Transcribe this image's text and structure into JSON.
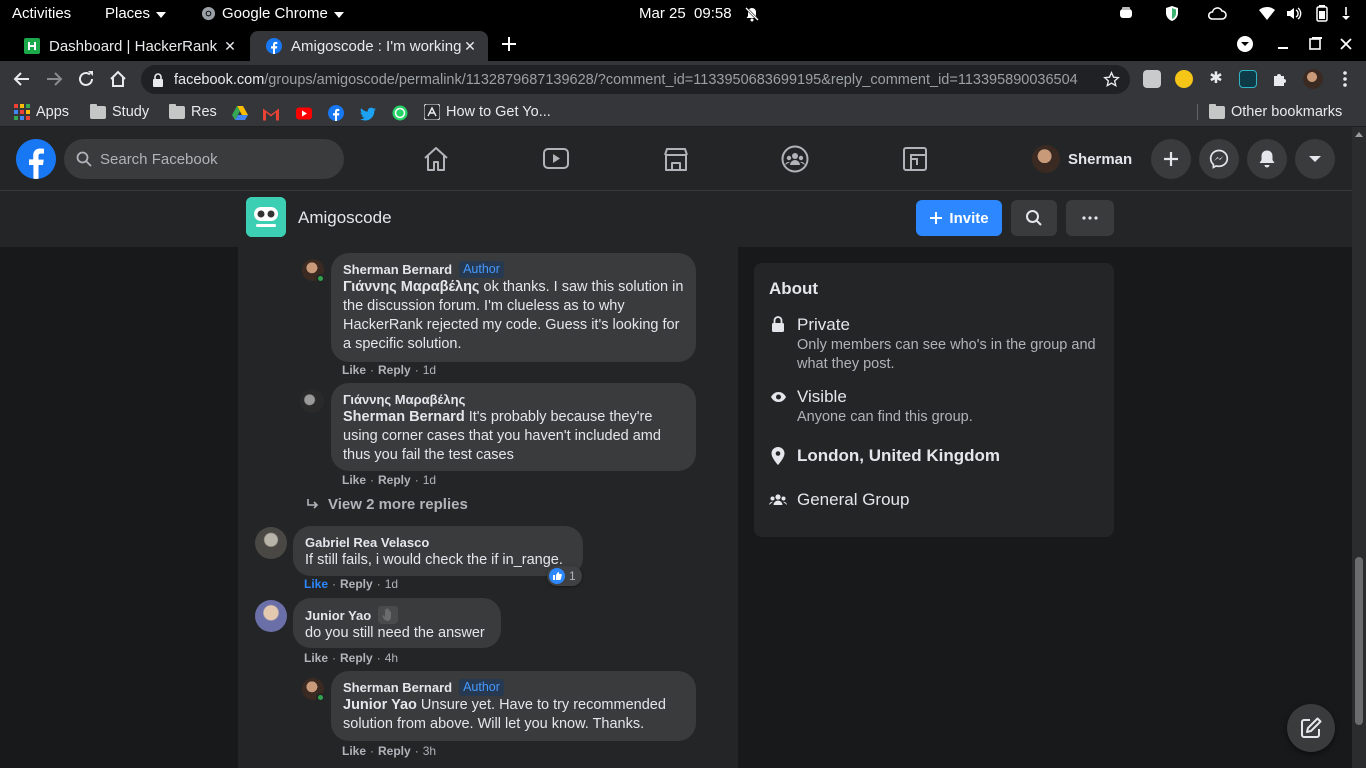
{
  "system_bar": {
    "activities": "Activities",
    "places": "Places",
    "app_name": "Google Chrome",
    "clock": "Mar 25  09:58"
  },
  "tabs": [
    {
      "title": "Dashboard | HackerRank",
      "active": false
    },
    {
      "title": "Amigoscode : I'm working on HackerRank",
      "active": true
    }
  ],
  "address_bar": {
    "domain": "facebook.com",
    "path": "/groups/amigoscode/permalink/1132879687139628/?comment_id=1133950683699195&reply_comment_id=113395890036504..."
  },
  "bookmarks": {
    "apps": "Apps",
    "study": "Study",
    "res": "Res",
    "how_to": "How to Get Yo...",
    "other": "Other bookmarks"
  },
  "facebook": {
    "search_placeholder": "Search Facebook",
    "user_name": "Sherman"
  },
  "group": {
    "name": "Amigoscode",
    "invite_label": "Invite"
  },
  "comments": [
    {
      "author": "Sherman Bernard",
      "badge": "Author",
      "mention": "Γιάννης Μαραβέλης",
      "text": " ok thanks. I saw this solution in the discussion forum. I'm clueless as to why HackerRank rejected my code. Guess it's looking for a specific solution.",
      "like": "Like",
      "reply": "Reply",
      "time": "1d"
    },
    {
      "author": "Γιάννης Μαραβέλης",
      "mention": "Sherman Bernard",
      "text": " It's probably because they're using corner cases that you haven't included amd thus you fail the test cases",
      "like": "Like",
      "reply": "Reply",
      "time": "1d"
    },
    {
      "author": "Gabriel Rea Velasco",
      "text": "If still fails, i would check the if in_range.",
      "like": "Like",
      "reply": "Reply",
      "time": "1d",
      "reaction_count": "1"
    },
    {
      "author": "Junior Yao",
      "text": "do you still need the answer",
      "like": "Like",
      "reply": "Reply",
      "time": "4h"
    },
    {
      "author": "Sherman Bernard",
      "badge": "Author",
      "mention": "Junior Yao",
      "text": " Unsure yet. Have to try recommended solution from above. Will let you know. Thanks.",
      "like": "Like",
      "reply": "Reply",
      "time": "3h"
    }
  ],
  "view_more_replies": "View 2 more replies",
  "about": {
    "title": "About",
    "privacy_title": "Private",
    "privacy_desc": "Only members can see who's in the group and what they post.",
    "visibility_title": "Visible",
    "visibility_desc": "Anyone can find this group.",
    "location": "London, United Kingdom",
    "group_type": "General Group"
  },
  "colors": {
    "fb_blue": "#1877f2",
    "invite_blue": "#2d88ff",
    "author_badge": "#4599ff",
    "online_green": "#31a24c"
  }
}
